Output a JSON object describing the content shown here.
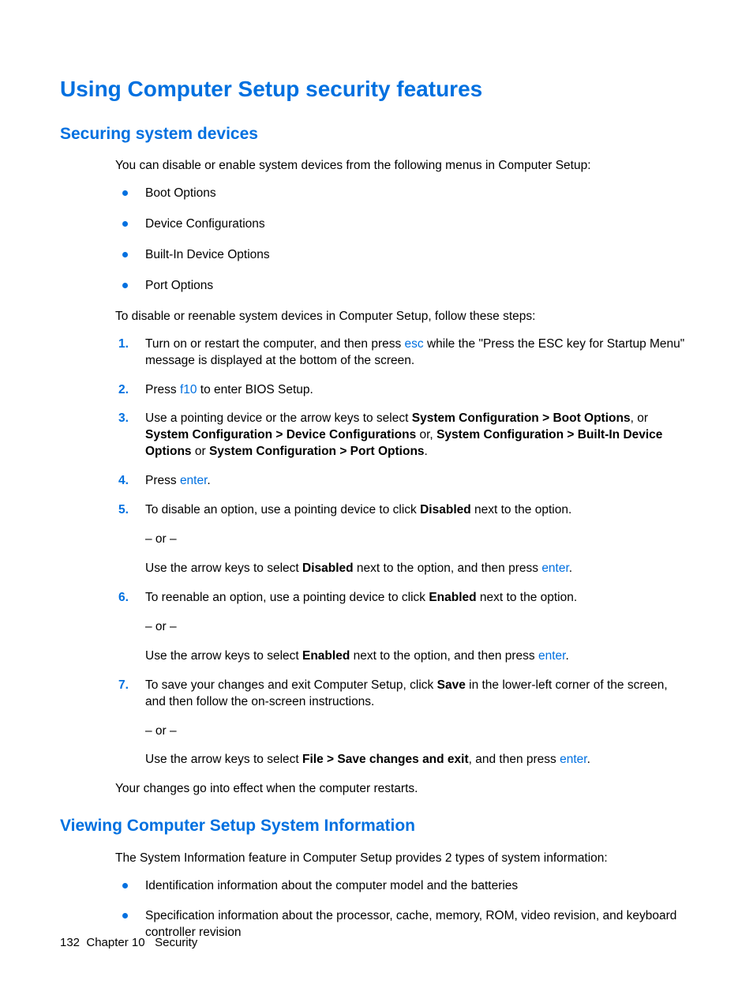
{
  "title": "Using Computer Setup security features",
  "section1": {
    "heading": "Securing system devices",
    "intro": "You can disable or enable system devices from the following menus in Computer Setup:",
    "bullets": [
      "Boot Options",
      "Device Configurations",
      "Built-In Device Options",
      "Port Options"
    ],
    "lead2": "To disable or reenable system devices in Computer Setup, follow these steps:",
    "steps": {
      "s1a": "Turn on or restart the computer, and then press ",
      "s1key": "esc",
      "s1b": " while the \"Press the ESC key for Startup Menu\" message is displayed at the bottom of the screen.",
      "s2a": "Press ",
      "s2key": "f10",
      "s2b": " to enter BIOS Setup.",
      "s3a": "Use a pointing device or the arrow keys to select ",
      "s3b1": "System Configuration > Boot Options",
      "s3c": ", or ",
      "s3b2": "System Configuration > Device Configurations",
      "s3d": " or, ",
      "s3b3": "System Configuration > Built-In Device Options",
      "s3e": " or ",
      "s3b4": "System Configuration > Port Options",
      "s3f": ".",
      "s4a": "Press ",
      "s4key": "enter",
      "s4b": ".",
      "s5a": "To disable an option, use a pointing device to click ",
      "s5b": "Disabled",
      "s5c": " next to the option.",
      "or": "– or –",
      "s5d": "Use the arrow keys to select ",
      "s5e": "Disabled",
      "s5f": " next to the option, and then press ",
      "s5key": "enter",
      "s5g": ".",
      "s6a": "To reenable an option, use a pointing device to click ",
      "s6b": "Enabled",
      "s6c": " next to the option.",
      "s6d": "Use the arrow keys to select ",
      "s6e": "Enabled",
      "s6f": " next to the option, and then press ",
      "s6key": "enter",
      "s6g": ".",
      "s7a": "To save your changes and exit Computer Setup, click ",
      "s7b": "Save",
      "s7c": " in the lower-left corner of the screen, and then follow the on-screen instructions.",
      "s7d": "Use the arrow keys to select ",
      "s7e": "File > Save changes and exit",
      "s7f": ", and then press ",
      "s7key": "enter",
      "s7g": "."
    },
    "closing": "Your changes go into effect when the computer restarts."
  },
  "section2": {
    "heading": "Viewing Computer Setup System Information",
    "intro": "The System Information feature in Computer Setup provides 2 types of system information:",
    "bullets": [
      "Identification information about the computer model and the batteries",
      "Specification information about the processor, cache, memory, ROM, video revision, and keyboard controller revision"
    ]
  },
  "footer": {
    "page": "132",
    "chapter": "Chapter 10",
    "title": "Security"
  }
}
